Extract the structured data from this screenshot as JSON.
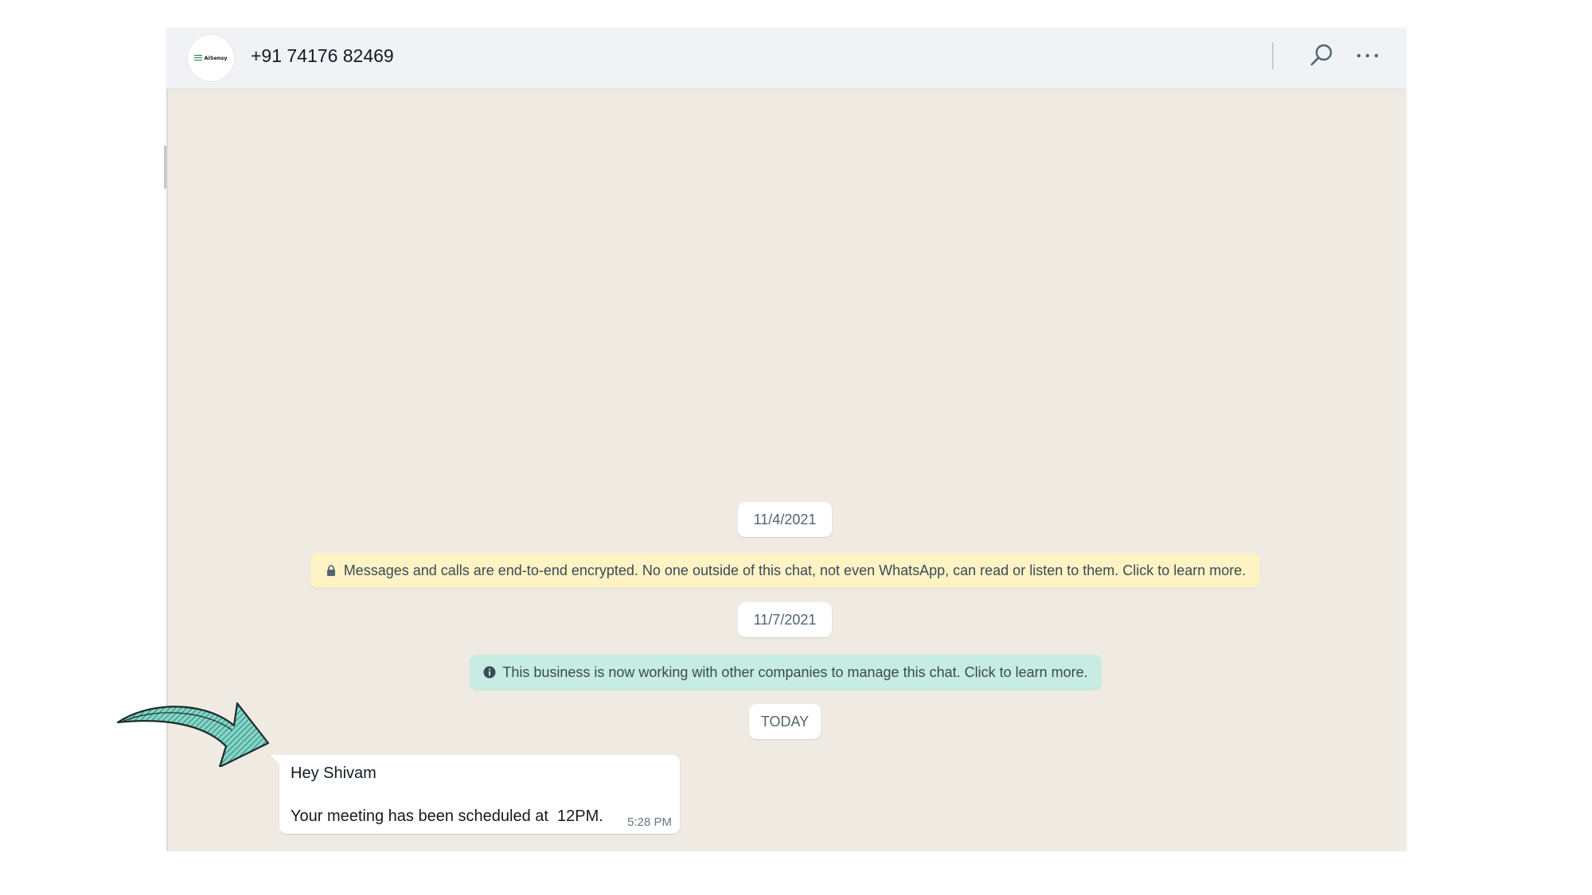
{
  "header": {
    "avatar_text": "AiSensy",
    "contact_name": "+91 74176 82469",
    "search_icon": "search-icon",
    "menu_icon": "more-options-icon"
  },
  "chat": {
    "dates": [
      "11/4/2021",
      "11/7/2021",
      "TODAY"
    ],
    "encryption_notice": "Messages and calls are end-to-end encrypted. No one outside of this chat, not even WhatsApp, can read or listen to them. Click to learn more.",
    "business_notice": "This business is now working with other companies to manage this chat. Click to learn more.",
    "message": {
      "line1": "Hey Shivam",
      "line2": "Your meeting has been scheduled at  12PM.",
      "time": "5:28 PM"
    }
  },
  "colors": {
    "chat_background": "#efeae2",
    "header_background": "#f0f2f5",
    "encryption_notice_bg": "#fdf3c5",
    "business_notice_bg": "#c6ece3",
    "arrow_fill": "#7fd8c8"
  }
}
